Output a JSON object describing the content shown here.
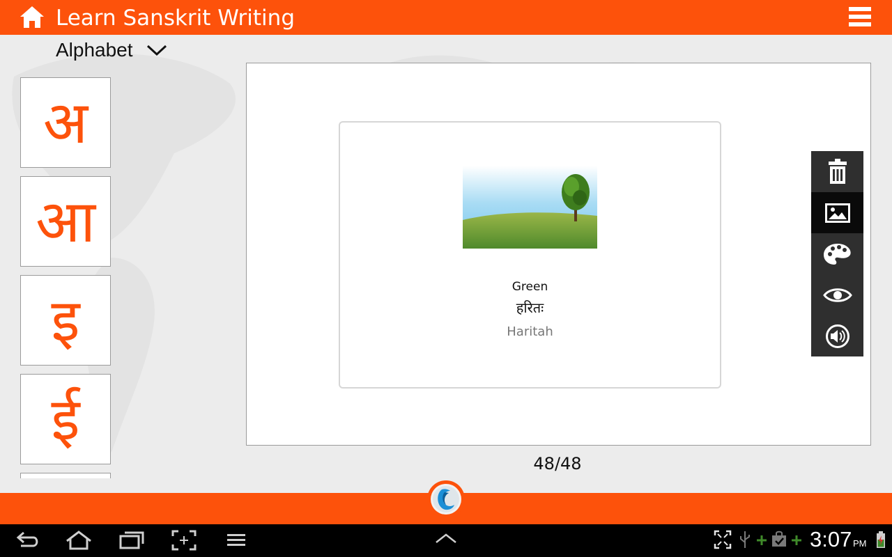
{
  "app": {
    "title": "Learn Sanskrit Writing",
    "accent_color": "#fd520b",
    "icons": {
      "home": "home-icon",
      "menu": "hamburger-menu-icon",
      "logo": "brand-wave-logo-icon"
    }
  },
  "category_dropdown": {
    "selected": "Alphabet",
    "icon": "chevron-down-icon"
  },
  "letters": [
    {
      "glyph": "अ"
    },
    {
      "glyph": "आ"
    },
    {
      "glyph": "इ"
    },
    {
      "glyph": "ई"
    }
  ],
  "card": {
    "image": "green-field-tree-picture",
    "english": "Green",
    "sanskrit": "हरितः",
    "transliteration": "Haritah"
  },
  "tools": [
    {
      "name": "trash-icon",
      "active": false
    },
    {
      "name": "image-icon",
      "active": true
    },
    {
      "name": "palette-icon",
      "active": false
    },
    {
      "name": "eye-icon",
      "active": false
    },
    {
      "name": "speaker-icon",
      "active": false
    }
  ],
  "pagination": {
    "current": 48,
    "total": 48,
    "label": "48/48"
  },
  "system_bar": {
    "time": "3:07",
    "ampm": "PM",
    "nav_icons": [
      "back-icon",
      "home-outline-icon",
      "recent-apps-icon",
      "screenshot-icon",
      "menu-lines-icon",
      "up-chevron-icon"
    ],
    "status_icons": [
      "fullscreen-icon",
      "usb-icon",
      "download-plus-icon",
      "shopping-bag-check-icon",
      "download-plus-icon",
      "battery-charging-icon"
    ]
  }
}
